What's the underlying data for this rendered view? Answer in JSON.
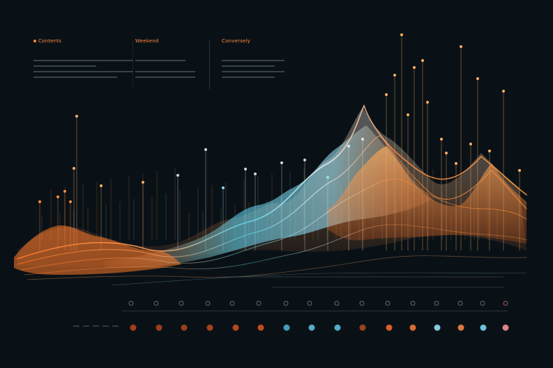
{
  "headers": [
    {
      "label": "Contents"
    },
    {
      "label": "Weekend"
    },
    {
      "label": "Conversely"
    }
  ],
  "colors": {
    "background": "#0a1116",
    "orange": "#ff8a3c",
    "cyan": "#5fd8f5",
    "white": "#eef3f5",
    "peach": "#ffc08a"
  }
}
